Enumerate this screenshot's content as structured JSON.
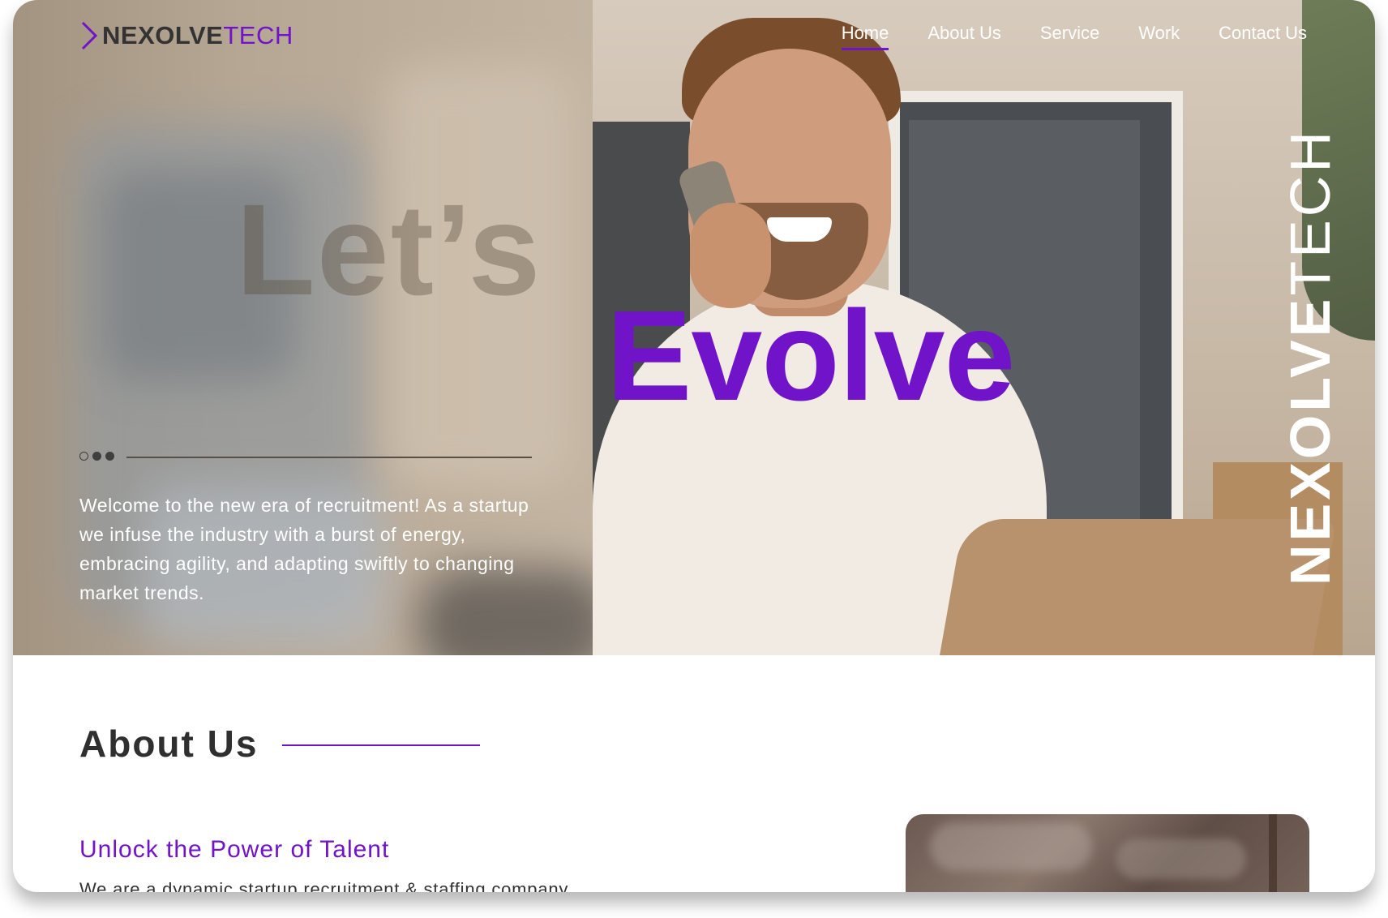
{
  "brand": {
    "logo_bold": "NEXOLVE",
    "logo_light": "TECH",
    "accent_color": "#7113c9"
  },
  "nav": {
    "items": [
      {
        "label": "Home",
        "active": true
      },
      {
        "label": "About Us",
        "active": false
      },
      {
        "label": "Service",
        "active": false
      },
      {
        "label": "Work",
        "active": false
      },
      {
        "label": "Contact Us",
        "active": false
      }
    ]
  },
  "hero": {
    "watermark": "Let’s",
    "headline": "Evolve",
    "vertical_bold": "NEXOLVE",
    "vertical_light": "TECH",
    "carousel": {
      "slides": 3,
      "active_index": 0
    },
    "paragraph": "Welcome to the new era of recruitment! As a startup we infuse the industry with a burst of energy, embracing agility, and adapting swiftly to changing market trends."
  },
  "about": {
    "heading": "About Us",
    "subheading": "Unlock the Power of Talent",
    "paragraph": "We are a dynamic startup recruitment & staffing company"
  }
}
